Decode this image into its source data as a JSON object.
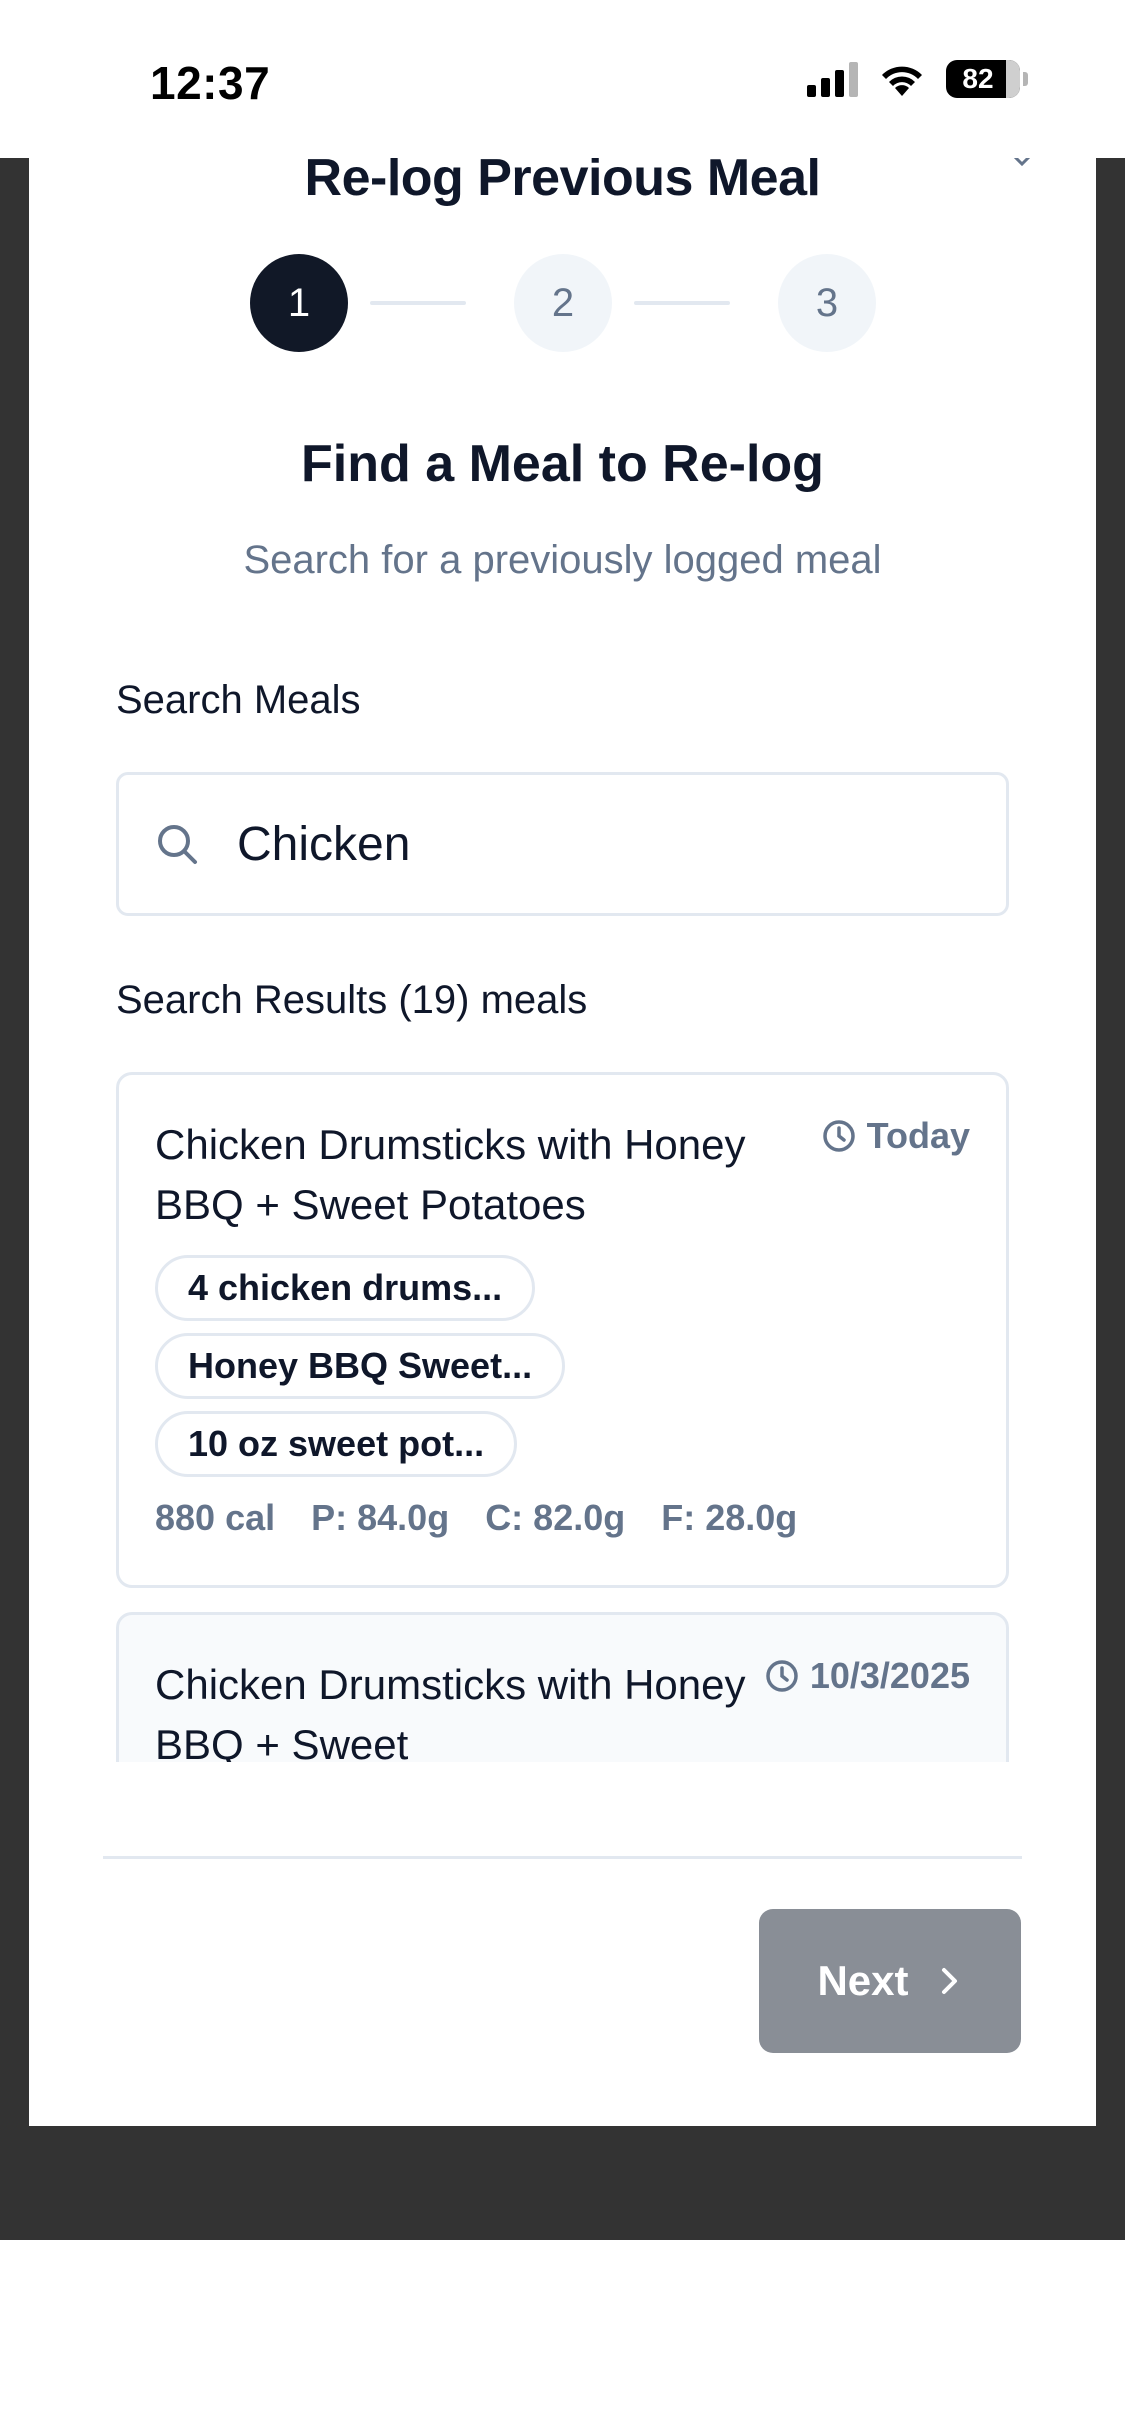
{
  "status_bar": {
    "time": "12:37",
    "battery": "82"
  },
  "modal": {
    "title": "Re-log Previous Meal",
    "steps": [
      "1",
      "2",
      "3"
    ],
    "active_step": 1
  },
  "step1": {
    "heading": "Find a Meal to Re-log",
    "subheading": "Search for a previously logged meal",
    "search_label": "Search Meals",
    "search_value": "Chicken",
    "results_label": "Search Results (19) meals"
  },
  "results": [
    {
      "title": "Chicken Drumsticks with Honey BBQ + Sweet Potatoes",
      "date": "Today",
      "chips": [
        "4 chicken drums...",
        "Honey BBQ Sweet...",
        "10 oz sweet pot..."
      ],
      "calories": "880 cal",
      "protein": "P: 84.0g",
      "carbs": "C: 82.0g",
      "fat": "F: 28.0g"
    },
    {
      "title": "Chicken Drumsticks with Honey BBQ + Sweet",
      "date": "10/3/2025"
    }
  ],
  "footer": {
    "next_label": "Next"
  },
  "colors": {
    "primary_dark": "#111827",
    "muted_text": "#64748b",
    "border": "#e2e8f0",
    "disabled_button": "#898e96",
    "backdrop": "#333333"
  }
}
